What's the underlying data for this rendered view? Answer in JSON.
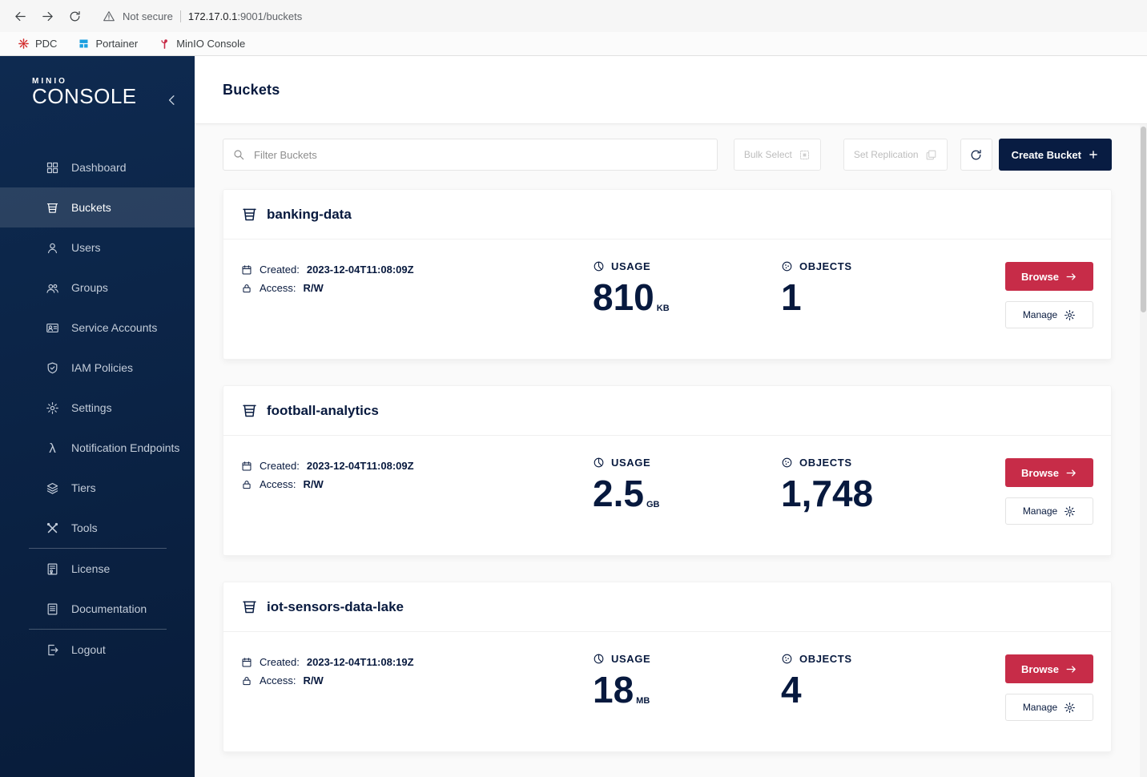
{
  "colors": {
    "sidebar_navy": "#0A2342",
    "brand_navy": "#081C42",
    "accent_red": "#C72C48",
    "page_bg": "#FAFAFA",
    "text_navy": "#07193E"
  },
  "browser": {
    "security_warning": "Not secure",
    "url_host": "172.17.0.1",
    "url_rest": ":9001/buckets",
    "bookmarks": [
      {
        "label": "PDC"
      },
      {
        "label": "Portainer"
      },
      {
        "label": "MinIO Console"
      }
    ]
  },
  "sidebar": {
    "logo_mark": "MINIO",
    "logo_text": "CONSOLE",
    "items": [
      {
        "label": "Dashboard"
      },
      {
        "label": "Buckets"
      },
      {
        "label": "Users"
      },
      {
        "label": "Groups"
      },
      {
        "label": "Service Accounts"
      },
      {
        "label": "IAM Policies"
      },
      {
        "label": "Settings"
      },
      {
        "label": "Notification Endpoints"
      },
      {
        "label": "Tiers"
      },
      {
        "label": "Tools"
      },
      {
        "label": "License"
      },
      {
        "label": "Documentation"
      },
      {
        "label": "Logout"
      }
    ]
  },
  "header": {
    "title": "Buckets"
  },
  "toolbar": {
    "filter_placeholder": "Filter Buckets",
    "bulk_select": "Bulk Select",
    "set_replication": "Set Replication",
    "create_bucket": "Create Bucket"
  },
  "card_labels": {
    "created": "Created:",
    "access": "Access:",
    "usage": "USAGE",
    "objects": "OBJECTS",
    "browse": "Browse",
    "manage": "Manage"
  },
  "buckets": [
    {
      "name": "banking-data",
      "created": "2023-12-04T11:08:09Z",
      "access": "R/W",
      "usage_value": "810",
      "usage_unit": "KB",
      "objects": "1"
    },
    {
      "name": "football-analytics",
      "created": "2023-12-04T11:08:09Z",
      "access": "R/W",
      "usage_value": "2.5",
      "usage_unit": "GB",
      "objects": "1,748"
    },
    {
      "name": "iot-sensors-data-lake",
      "created": "2023-12-04T11:08:19Z",
      "access": "R/W",
      "usage_value": "18",
      "usage_unit": "MB",
      "objects": "4"
    }
  ],
  "icons": {
    "lambda_glyph": "λ"
  }
}
